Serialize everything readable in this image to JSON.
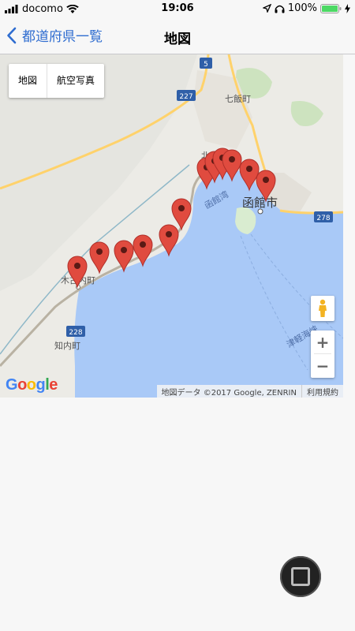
{
  "status": {
    "carrier": "docomo",
    "time": "19:06",
    "battery": "100%"
  },
  "nav": {
    "back_label": "都道府県一覧",
    "title": "地図"
  },
  "map": {
    "type_buttons": [
      "地図",
      "航空写真"
    ],
    "places": {
      "hakodate": "函館市",
      "nanae": "七飯町",
      "kikonai": "木古内町",
      "shiriuchi": "知内町",
      "hakodate_bay": "函館湾",
      "tsugaru_strait": "津軽海峡",
      "hokuto": "北斗市"
    },
    "routes": [
      "5",
      "227",
      "278",
      "228"
    ],
    "logo": "Google",
    "attribution": "地図データ ©2017 Google, ZENRIN",
    "terms": "利用規約",
    "zoom_in": "+",
    "zoom_out": "−",
    "marker_color": "#e04b3f",
    "water_color": "#a9c9f7"
  }
}
